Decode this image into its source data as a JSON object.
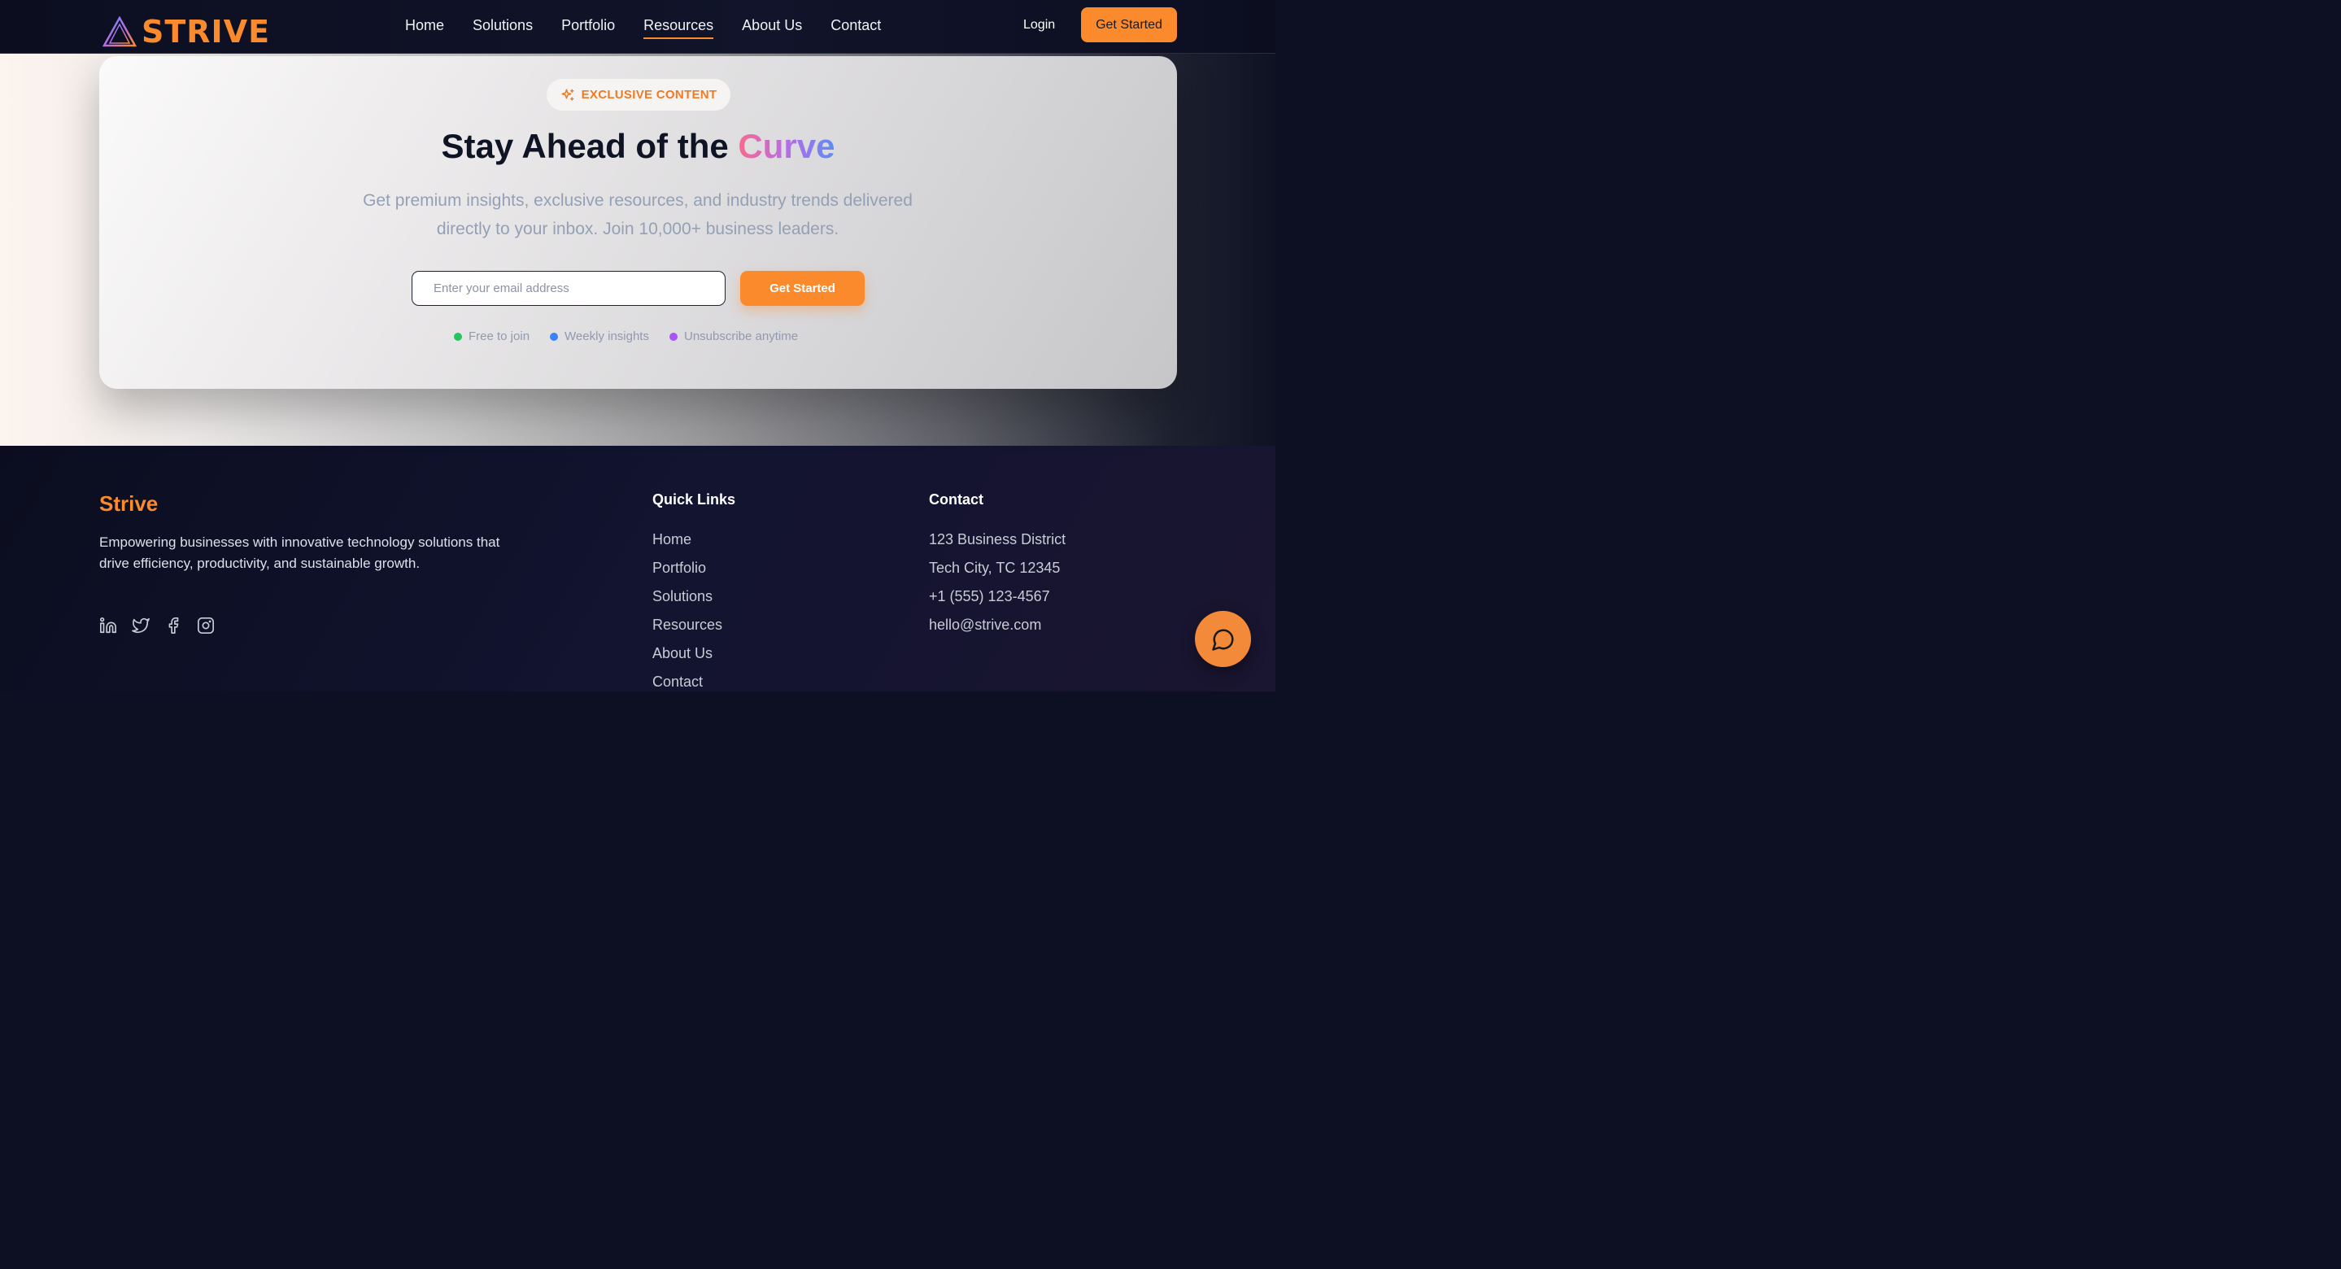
{
  "nav": {
    "logo_text": "STRIVE",
    "links": [
      "Home",
      "Solutions",
      "Portfolio",
      "Resources",
      "About Us",
      "Contact"
    ],
    "active_link": "Resources",
    "login_label": "Login",
    "cta_label": "Get Started"
  },
  "hero": {
    "badge": "EXCLUSIVE CONTENT",
    "headline_plain": "Stay Ahead of the ",
    "headline_accent": "Curve",
    "subtitle": "Get premium insights, exclusive resources, and industry trends delivered directly to your inbox. Join 10,000+ business leaders.",
    "email_placeholder": "Enter your email address",
    "cta_label": "Get Started",
    "perks": [
      {
        "label": "Free to join",
        "color": "#22c55e"
      },
      {
        "label": "Weekly insights",
        "color": "#3b82f6"
      },
      {
        "label": "Unsubscribe anytime",
        "color": "#a855f7"
      }
    ]
  },
  "footer": {
    "brand": "Strive",
    "description": "Empowering businesses with innovative technology solutions that drive efficiency, productivity, and sustainable growth.",
    "socials": [
      "linkedin-icon",
      "twitter-icon",
      "facebook-icon",
      "instagram-icon"
    ],
    "quick_links_title": "Quick Links",
    "quick_links": [
      "Home",
      "Portfolio",
      "Solutions",
      "Resources",
      "About Us",
      "Contact"
    ],
    "contact_title": "Contact",
    "contact_lines": [
      "123 Business District",
      "Tech City, TC 12345",
      "+1 (555) 123-4567",
      "hello@strive.com"
    ]
  },
  "colors": {
    "accent": "#fb8a2c",
    "navy": "#0d0f22"
  }
}
